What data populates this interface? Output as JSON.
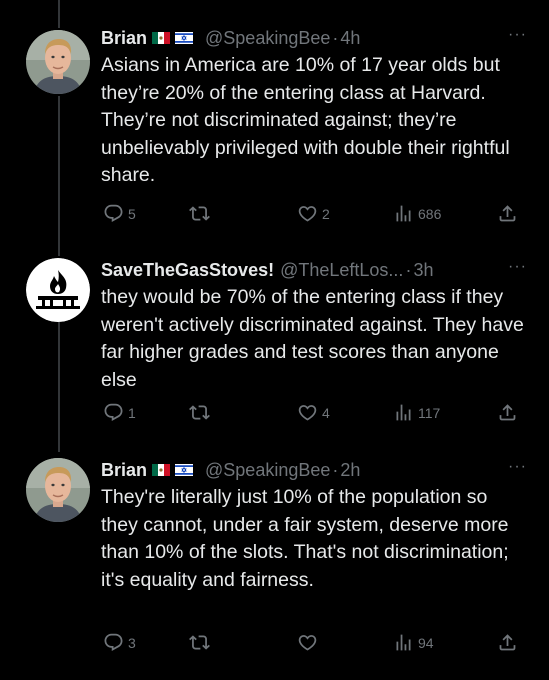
{
  "colors": {
    "background": "#000000",
    "text": "#e7e9ea",
    "muted": "#71767b",
    "thread_line": "#333639"
  },
  "tweets": [
    {
      "name": "Brian",
      "flags": [
        "mexico-flag-icon",
        "israel-flag-icon"
      ],
      "handle": "@SpeakingBee",
      "sep": "·",
      "time": "4h",
      "more": "···",
      "text": "Asians in America are 10% of 17 year olds but they’re 20% of the entering class at Harvard. They’re not discriminated against; they’re unbelievably privileged with double their rightful share.",
      "replies": "5",
      "retweets": "",
      "likes": "2",
      "views": "686"
    },
    {
      "name": "SaveTheGasStoves!",
      "flags": [],
      "handle": "@TheLeftLos...",
      "sep": "·",
      "time": "3h",
      "more": "···",
      "text": "they would be 70% of the entering class if they weren't actively discriminated against. They have far higher grades and test scores than anyone else",
      "replies": "1",
      "retweets": "",
      "likes": "4",
      "views": "117"
    },
    {
      "name": "Brian",
      "flags": [
        "mexico-flag-icon",
        "israel-flag-icon"
      ],
      "handle": "@SpeakingBee",
      "sep": "·",
      "time": "2h",
      "more": "···",
      "text": "They're literally just 10% of the population so they cannot, under a fair system, deserve more than 10% of the slots. That's not discrimination; it's equality and fairness.",
      "replies": "3",
      "retweets": "",
      "likes": "",
      "views": "94"
    }
  ]
}
